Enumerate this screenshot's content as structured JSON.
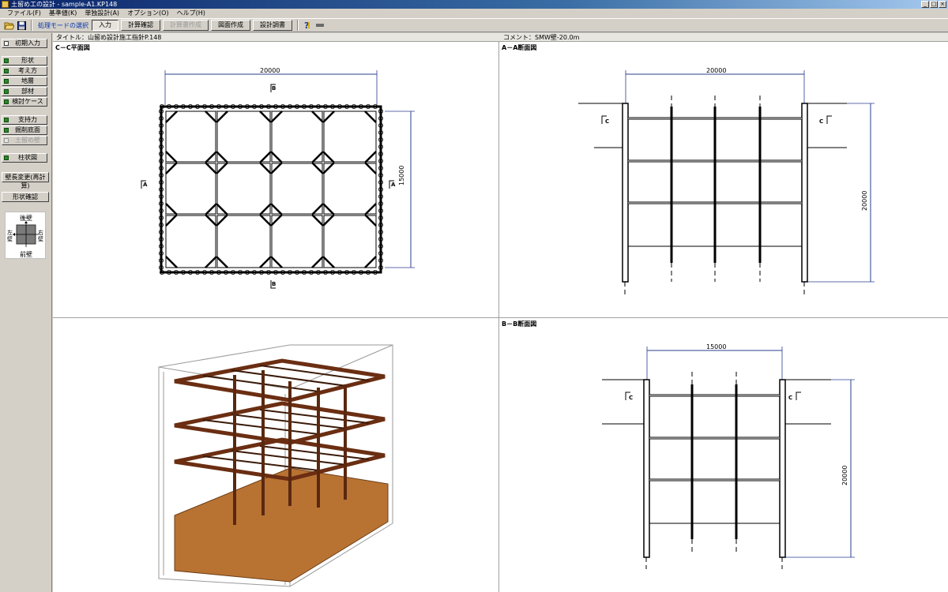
{
  "window": {
    "title": "土留め工の設計 - sample-A1.KP148"
  },
  "menu": {
    "items": [
      "ファイル(F)",
      "基準値(K)",
      "単独設計(A)",
      "オプション(O)",
      "ヘルプ(H)"
    ]
  },
  "toolbar": {
    "mode_label": "処理モードの選択",
    "buttons": [
      "入力",
      "計算確認",
      "計算書作成",
      "図面作成",
      "設計調書"
    ]
  },
  "sidebar": {
    "initial": "初期入力",
    "group1": [
      "形状",
      "考え方",
      "地層",
      "部材",
      "検討ケース"
    ],
    "group2": [
      "支持力",
      "掘削底面",
      "土留め壁"
    ],
    "pillar": "柱状図",
    "recalc": "壁長変更(再計算)",
    "shape_check": "形状確認",
    "walls": {
      "back": "後壁",
      "front": "前壁",
      "left": "左壁",
      "right": "右壁"
    }
  },
  "info": {
    "title": "タイトル：山留め設計施工指針P.148",
    "comment": "コメント：SMW壁-20.0m"
  },
  "panes": {
    "plan": {
      "title": "C－C平面図",
      "width_dim": "20000",
      "height_dim": "15000",
      "marks": {
        "top": "B",
        "bottom": "B",
        "left": "A",
        "right": "A"
      }
    },
    "section_a": {
      "title": "A－A断面図",
      "width_dim": "20000",
      "height_dim": "20000",
      "marks": {
        "left": "C",
        "right": "C"
      }
    },
    "section_b": {
      "title": "B－B断面図",
      "width_dim": "15000",
      "height_dim": "20000",
      "marks": {
        "left": "C",
        "right": "C"
      }
    }
  },
  "colors": {
    "dimension": "#2b3c8f",
    "strut": "#6b2e12",
    "ground": "#b87333"
  }
}
